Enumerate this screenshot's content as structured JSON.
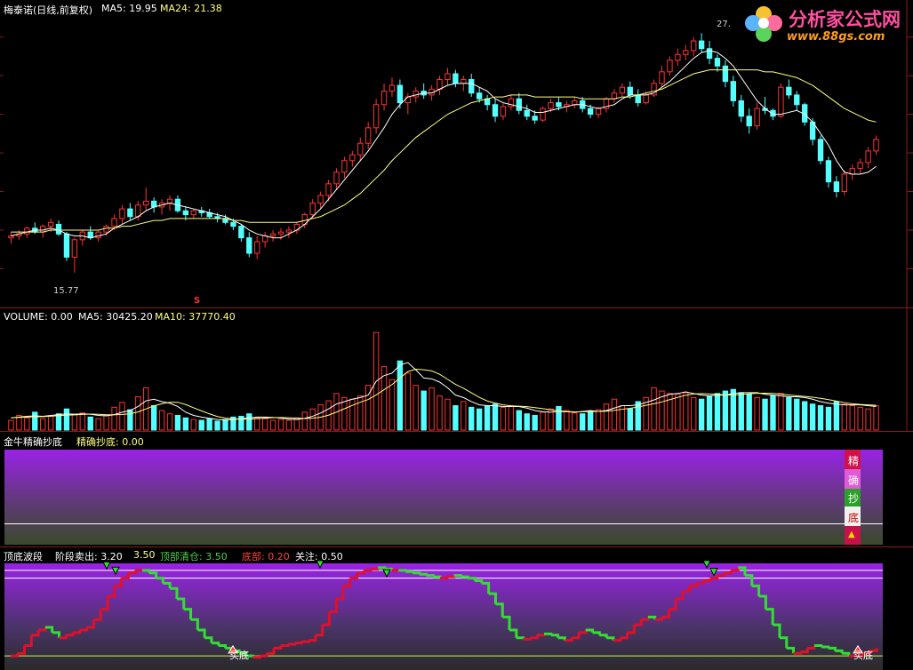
{
  "price_pane": {
    "stock_name": "梅泰诺(日线,前复权)",
    "ma5_label": "MA5: 19.95",
    "ma24_label": "MA24: 21.38",
    "high_marker": "27.",
    "low_marker": "15.77",
    "signal_marker": "S",
    "colors": {
      "up": "#ff3232",
      "down": "#54ffff",
      "ma5": "#ffffff",
      "ma24": "#ffff80"
    }
  },
  "volume_pane": {
    "title": "VOLUME: 0.00",
    "ma5_label": "MA5: 30425.20",
    "ma10_label": "MA10: 37770.40"
  },
  "jinniu_pane": {
    "title": "金牛精确抄底",
    "value_label": "精确抄底: 0.00",
    "indicator_chars": [
      "精",
      "确",
      "抄",
      "底"
    ]
  },
  "wave_pane": {
    "title": "顶底波段",
    "sell_label": "阶段卖出: 3.20",
    "sell_value2": "3.50",
    "clear_label": "顶部清仓: 3.50",
    "bottom_label": "底部: 0.20",
    "watch_label": "关注: 0.50",
    "buy_marker_1": "买底",
    "buy_marker_2": "买底"
  },
  "logo": {
    "name": "分析家公式网",
    "url": "www.88gs.com"
  },
  "chart_data": {
    "type": "candlestick",
    "ylim": [
      14.5,
      29
    ],
    "candles": [
      [
        17.6,
        17.9,
        17.3,
        17.7
      ],
      [
        17.7,
        18.0,
        17.5,
        17.8
      ],
      [
        17.8,
        18.2,
        17.6,
        18.1
      ],
      [
        18.1,
        18.4,
        17.8,
        17.9
      ],
      [
        17.9,
        18.3,
        17.6,
        18.2
      ],
      [
        18.2,
        18.6,
        17.9,
        18.4
      ],
      [
        18.3,
        18.5,
        17.7,
        17.8
      ],
      [
        17.8,
        17.9,
        16.4,
        16.6
      ],
      [
        16.6,
        17.6,
        15.8,
        17.5
      ],
      [
        17.5,
        18.0,
        17.2,
        17.9
      ],
      [
        17.9,
        18.2,
        17.5,
        17.6
      ],
      [
        17.6,
        18.0,
        17.4,
        17.9
      ],
      [
        17.9,
        18.3,
        17.7,
        18.2
      ],
      [
        18.2,
        18.8,
        18.0,
        18.6
      ],
      [
        18.6,
        19.3,
        18.3,
        19.1
      ],
      [
        19.1,
        19.4,
        18.5,
        18.7
      ],
      [
        18.7,
        19.5,
        18.5,
        19.3
      ],
      [
        19.3,
        20.2,
        19.0,
        19.5
      ],
      [
        19.5,
        19.7,
        18.9,
        19.2
      ],
      [
        19.2,
        19.6,
        18.8,
        19.4
      ],
      [
        19.4,
        19.8,
        19.0,
        19.6
      ],
      [
        19.6,
        19.8,
        18.9,
        19.0
      ],
      [
        19.0,
        19.2,
        18.5,
        18.8
      ],
      [
        18.8,
        19.1,
        18.6,
        19.0
      ],
      [
        19.0,
        19.2,
        18.7,
        18.9
      ],
      [
        18.9,
        19.1,
        18.6,
        18.7
      ],
      [
        18.7,
        18.9,
        18.4,
        18.6
      ],
      [
        18.6,
        18.8,
        18.3,
        18.4
      ],
      [
        18.4,
        18.6,
        18.0,
        18.2
      ],
      [
        18.2,
        18.3,
        17.4,
        17.6
      ],
      [
        17.6,
        17.9,
        16.6,
        16.8
      ],
      [
        16.8,
        17.7,
        16.5,
        17.4
      ],
      [
        17.4,
        17.9,
        17.1,
        17.7
      ],
      [
        17.7,
        18.0,
        17.4,
        17.8
      ],
      [
        17.8,
        18.1,
        17.5,
        17.9
      ],
      [
        17.9,
        18.2,
        17.6,
        18.0
      ],
      [
        18.0,
        18.4,
        17.8,
        18.3
      ],
      [
        18.3,
        18.9,
        18.1,
        18.8
      ],
      [
        18.8,
        19.6,
        18.6,
        19.4
      ],
      [
        19.4,
        20.0,
        19.1,
        19.8
      ],
      [
        19.8,
        20.6,
        19.5,
        20.4
      ],
      [
        20.4,
        21.2,
        20.1,
        21.0
      ],
      [
        21.0,
        21.8,
        20.7,
        21.6
      ],
      [
        21.6,
        22.1,
        21.3,
        21.9
      ],
      [
        21.9,
        22.8,
        21.6,
        22.5
      ],
      [
        22.5,
        23.6,
        22.2,
        23.3
      ],
      [
        23.3,
        24.8,
        23.0,
        24.5
      ],
      [
        24.5,
        25.6,
        24.2,
        25.2
      ],
      [
        25.2,
        25.9,
        24.9,
        25.5
      ],
      [
        25.5,
        25.8,
        24.3,
        24.6
      ],
      [
        24.6,
        25.1,
        24.0,
        24.9
      ],
      [
        24.9,
        25.4,
        24.6,
        25.2
      ],
      [
        25.2,
        25.6,
        24.8,
        25.0
      ],
      [
        25.0,
        25.5,
        24.7,
        25.3
      ],
      [
        25.3,
        26.0,
        25.0,
        25.8
      ],
      [
        25.8,
        26.4,
        25.5,
        26.1
      ],
      [
        26.1,
        26.3,
        25.4,
        25.6
      ],
      [
        25.6,
        26.0,
        25.2,
        25.8
      ],
      [
        25.8,
        26.1,
        24.9,
        25.1
      ],
      [
        25.1,
        25.4,
        24.6,
        24.8
      ],
      [
        24.8,
        25.0,
        24.2,
        24.5
      ],
      [
        24.5,
        24.8,
        23.6,
        23.9
      ],
      [
        23.9,
        24.6,
        23.7,
        24.4
      ],
      [
        24.4,
        25.0,
        24.2,
        24.8
      ],
      [
        24.8,
        25.1,
        24.0,
        24.2
      ],
      [
        24.2,
        24.5,
        23.7,
        23.9
      ],
      [
        23.9,
        24.2,
        23.5,
        23.7
      ],
      [
        23.7,
        24.4,
        23.6,
        24.3
      ],
      [
        24.3,
        24.8,
        24.1,
        24.6
      ],
      [
        24.6,
        24.9,
        24.2,
        24.4
      ],
      [
        24.4,
        24.7,
        24.1,
        24.5
      ],
      [
        24.5,
        24.9,
        24.3,
        24.7
      ],
      [
        24.7,
        24.9,
        24.1,
        24.3
      ],
      [
        24.3,
        24.5,
        23.8,
        24.0
      ],
      [
        24.0,
        24.4,
        23.8,
        24.3
      ],
      [
        24.3,
        24.9,
        24.1,
        24.8
      ],
      [
        24.8,
        25.3,
        24.6,
        25.1
      ],
      [
        25.1,
        25.6,
        24.9,
        25.4
      ],
      [
        25.4,
        25.7,
        24.8,
        25.0
      ],
      [
        25.0,
        25.3,
        24.4,
        24.6
      ],
      [
        24.6,
        25.2,
        24.5,
        25.0
      ],
      [
        25.0,
        25.8,
        24.9,
        25.6
      ],
      [
        25.6,
        26.5,
        25.4,
        26.2
      ],
      [
        26.2,
        27.0,
        26.0,
        26.8
      ],
      [
        26.8,
        27.4,
        26.5,
        27.1
      ],
      [
        27.1,
        27.6,
        26.8,
        27.3
      ],
      [
        27.3,
        28.0,
        27.0,
        27.8
      ],
      [
        27.8,
        28.2,
        27.2,
        27.4
      ],
      [
        27.4,
        27.8,
        26.6,
        26.9
      ],
      [
        26.9,
        27.1,
        26.2,
        26.5
      ],
      [
        26.5,
        26.8,
        25.4,
        25.7
      ],
      [
        25.7,
        26.0,
        24.4,
        24.7
      ],
      [
        24.7,
        25.0,
        23.6,
        23.9
      ],
      [
        23.9,
        24.3,
        23.0,
        23.4
      ],
      [
        23.4,
        24.6,
        23.2,
        24.3
      ],
      [
        24.3,
        24.9,
        24.0,
        24.2
      ],
      [
        24.2,
        24.3,
        23.7,
        23.9
      ],
      [
        23.9,
        25.6,
        23.8,
        25.4
      ],
      [
        25.4,
        25.8,
        24.8,
        25.0
      ],
      [
        25.0,
        25.2,
        24.2,
        24.5
      ],
      [
        24.5,
        24.6,
        23.4,
        23.6
      ],
      [
        23.6,
        23.8,
        22.4,
        22.7
      ],
      [
        22.7,
        22.9,
        21.4,
        21.6
      ],
      [
        21.6,
        21.8,
        20.2,
        20.5
      ],
      [
        20.5,
        20.8,
        19.7,
        20.0
      ],
      [
        20.0,
        21.1,
        19.8,
        20.9
      ],
      [
        20.9,
        21.4,
        20.6,
        21.2
      ],
      [
        21.2,
        21.7,
        20.9,
        21.5
      ],
      [
        21.5,
        22.3,
        21.2,
        22.1
      ],
      [
        22.1,
        22.9,
        21.9,
        22.7
      ]
    ],
    "ma5": [
      17.7,
      17.8,
      17.9,
      18.0,
      18.0,
      18.1,
      18.0,
      17.8,
      17.7,
      17.7,
      17.6,
      17.7,
      17.8,
      18.1,
      18.3,
      18.5,
      18.7,
      19.0,
      19.2,
      19.3,
      19.4,
      19.3,
      19.2,
      19.1,
      19.0,
      18.9,
      18.8,
      18.7,
      18.5,
      18.3,
      18.0,
      17.8,
      17.7,
      17.6,
      17.6,
      17.8,
      18.0,
      18.3,
      18.7,
      19.1,
      19.6,
      20.1,
      20.6,
      21.1,
      21.6,
      22.1,
      22.7,
      23.3,
      24.0,
      24.5,
      24.9,
      25.0,
      25.1,
      25.1,
      25.3,
      25.5,
      25.6,
      25.6,
      25.6,
      25.4,
      25.2,
      24.8,
      24.6,
      24.5,
      24.4,
      24.3,
      24.1,
      24.1,
      24.2,
      24.3,
      24.4,
      24.5,
      24.5,
      24.4,
      24.3,
      24.4,
      24.5,
      24.8,
      25.0,
      25.0,
      25.0,
      25.1,
      25.4,
      25.7,
      26.1,
      26.5,
      26.9,
      27.2,
      27.3,
      27.2,
      26.9,
      26.5,
      25.9,
      25.3,
      24.7,
      24.3,
      24.0,
      24.0,
      24.1,
      24.2,
      24.0,
      23.6,
      23.0,
      22.4,
      21.6,
      21.0,
      20.9,
      20.9,
      21.0,
      21.3
    ],
    "ma24": [
      17.9,
      17.9,
      17.9,
      17.9,
      17.9,
      18.0,
      18.0,
      18.0,
      18.0,
      18.0,
      18.0,
      18.0,
      18.1,
      18.1,
      18.2,
      18.2,
      18.3,
      18.4,
      18.5,
      18.5,
      18.6,
      18.6,
      18.6,
      18.6,
      18.6,
      18.6,
      18.6,
      18.6,
      18.5,
      18.5,
      18.4,
      18.4,
      18.4,
      18.4,
      18.4,
      18.4,
      18.4,
      18.5,
      18.6,
      18.7,
      18.9,
      19.1,
      19.3,
      19.6,
      19.9,
      20.3,
      20.7,
      21.1,
      21.6,
      22.0,
      22.4,
      22.8,
      23.1,
      23.4,
      23.7,
      24.0,
      24.2,
      24.4,
      24.6,
      24.7,
      24.8,
      24.9,
      24.9,
      25.0,
      25.0,
      25.0,
      24.9,
      24.9,
      24.9,
      24.9,
      24.9,
      24.9,
      24.8,
      24.8,
      24.8,
      24.8,
      24.8,
      24.9,
      24.9,
      25.0,
      25.1,
      25.2,
      25.3,
      25.5,
      25.7,
      25.9,
      26.1,
      26.2,
      26.3,
      26.3,
      26.3,
      26.3,
      26.3,
      26.3,
      26.3,
      26.2,
      26.2,
      26.1,
      26.0,
      25.9,
      25.7,
      25.5,
      25.2,
      24.9,
      24.6,
      24.3,
      24.1,
      23.9,
      23.7,
      23.6
    ],
    "volume_ylim": [
      0,
      130000
    ],
    "volume": [
      12000,
      18000,
      15000,
      22000,
      14000,
      17000,
      20000,
      26000,
      19000,
      21000,
      16000,
      14000,
      18000,
      28000,
      34000,
      25000,
      41000,
      52000,
      30000,
      24000,
      20000,
      18000,
      15000,
      13000,
      12000,
      14000,
      11000,
      13000,
      16000,
      17000,
      20000,
      15000,
      14000,
      12000,
      13000,
      12000,
      15000,
      22000,
      26000,
      31000,
      36000,
      45000,
      40000,
      38000,
      42000,
      55000,
      120000,
      78000,
      62000,
      85000,
      70000,
      55000,
      48000,
      52000,
      42000,
      38000,
      30000,
      35000,
      28000,
      26000,
      30000,
      32000,
      28000,
      30000,
      24000,
      20000,
      18000,
      22000,
      26000,
      29000,
      24000,
      21000,
      20000,
      23000,
      25000,
      32000,
      38000,
      30000,
      26000,
      35000,
      40000,
      52000,
      48000,
      45000,
      44000,
      46000,
      40000,
      38000,
      42000,
      45000,
      48000,
      50000,
      46000,
      44000,
      40000,
      38000,
      42000,
      45000,
      40000,
      38000,
      35000,
      32000,
      30000,
      28000,
      35000,
      32000,
      30000,
      28000,
      26000,
      30000
    ],
    "volume_ma5": [
      15000,
      16000,
      17000,
      17500,
      17000,
      18000,
      19000,
      20000,
      19500,
      20000,
      19500,
      18000,
      17500,
      19000,
      22000,
      24000,
      29000,
      36000,
      38000,
      35000,
      33000,
      29000,
      22000,
      18000,
      16000,
      14500,
      13000,
      12500,
      13000,
      14000,
      15000,
      16000,
      16000,
      15500,
      14800,
      13500,
      13000,
      14500,
      17000,
      21000,
      26000,
      32000,
      35000,
      38000,
      40000,
      43000,
      60000,
      67000,
      70000,
      80000,
      83000,
      74000,
      64000,
      63000,
      59000,
      52000,
      43000,
      40000,
      35000,
      31000,
      30000,
      30000,
      29000,
      29000,
      29000,
      27000,
      24000,
      22500,
      22000,
      23000,
      22500,
      22000,
      23000,
      24000,
      23000,
      24000,
      27000,
      30000,
      30000,
      31000,
      34000,
      37000,
      41000,
      44000,
      45000,
      47000,
      45000,
      43000,
      42000,
      43000,
      43000,
      45000,
      46000,
      46000,
      46000,
      44000,
      43000,
      42000,
      41000,
      41000,
      40000,
      38000,
      35000,
      33000,
      32000,
      31000,
      31000,
      31000,
      30000,
      29000
    ],
    "wave_ylim": [
      0,
      3.7
    ],
    "wave": [
      0.2,
      0.3,
      0.6,
      1.0,
      1.2,
      1.3,
      1.1,
      0.9,
      1.0,
      1.1,
      1.2,
      1.3,
      1.6,
      2.0,
      2.5,
      2.9,
      3.2,
      3.4,
      3.5,
      3.5,
      3.4,
      3.2,
      3.0,
      2.8,
      2.4,
      2.0,
      1.6,
      1.2,
      0.9,
      0.7,
      0.6,
      0.5,
      0.4,
      0.3,
      0.2,
      0.15,
      0.2,
      0.3,
      0.5,
      0.6,
      0.65,
      0.7,
      0.75,
      0.8,
      1.0,
      1.4,
      1.9,
      2.4,
      2.9,
      3.2,
      3.4,
      3.5,
      3.55,
      3.6,
      3.55,
      3.5,
      3.5,
      3.45,
      3.4,
      3.35,
      3.3,
      3.25,
      3.2,
      3.25,
      3.3,
      3.25,
      3.2,
      3.1,
      3.0,
      2.6,
      2.2,
      1.7,
      1.2,
      0.9,
      0.85,
      0.9,
      1.0,
      1.05,
      1.0,
      0.9,
      0.8,
      0.9,
      1.1,
      1.2,
      1.1,
      1.0,
      0.9,
      0.8,
      0.9,
      1.1,
      1.4,
      1.6,
      1.7,
      1.6,
      1.7,
      2.0,
      2.4,
      2.7,
      2.9,
      3.0,
      3.1,
      3.2,
      3.3,
      3.4,
      3.5,
      3.6,
      3.3,
      2.9,
      2.5,
      2.0,
      1.4,
      0.9,
      0.5,
      0.3,
      0.35,
      0.5,
      0.6,
      0.55,
      0.5,
      0.4,
      0.3,
      0.2,
      0.2,
      0.3,
      0.4,
      0.5
    ],
    "jinniu_value": 0.0
  }
}
